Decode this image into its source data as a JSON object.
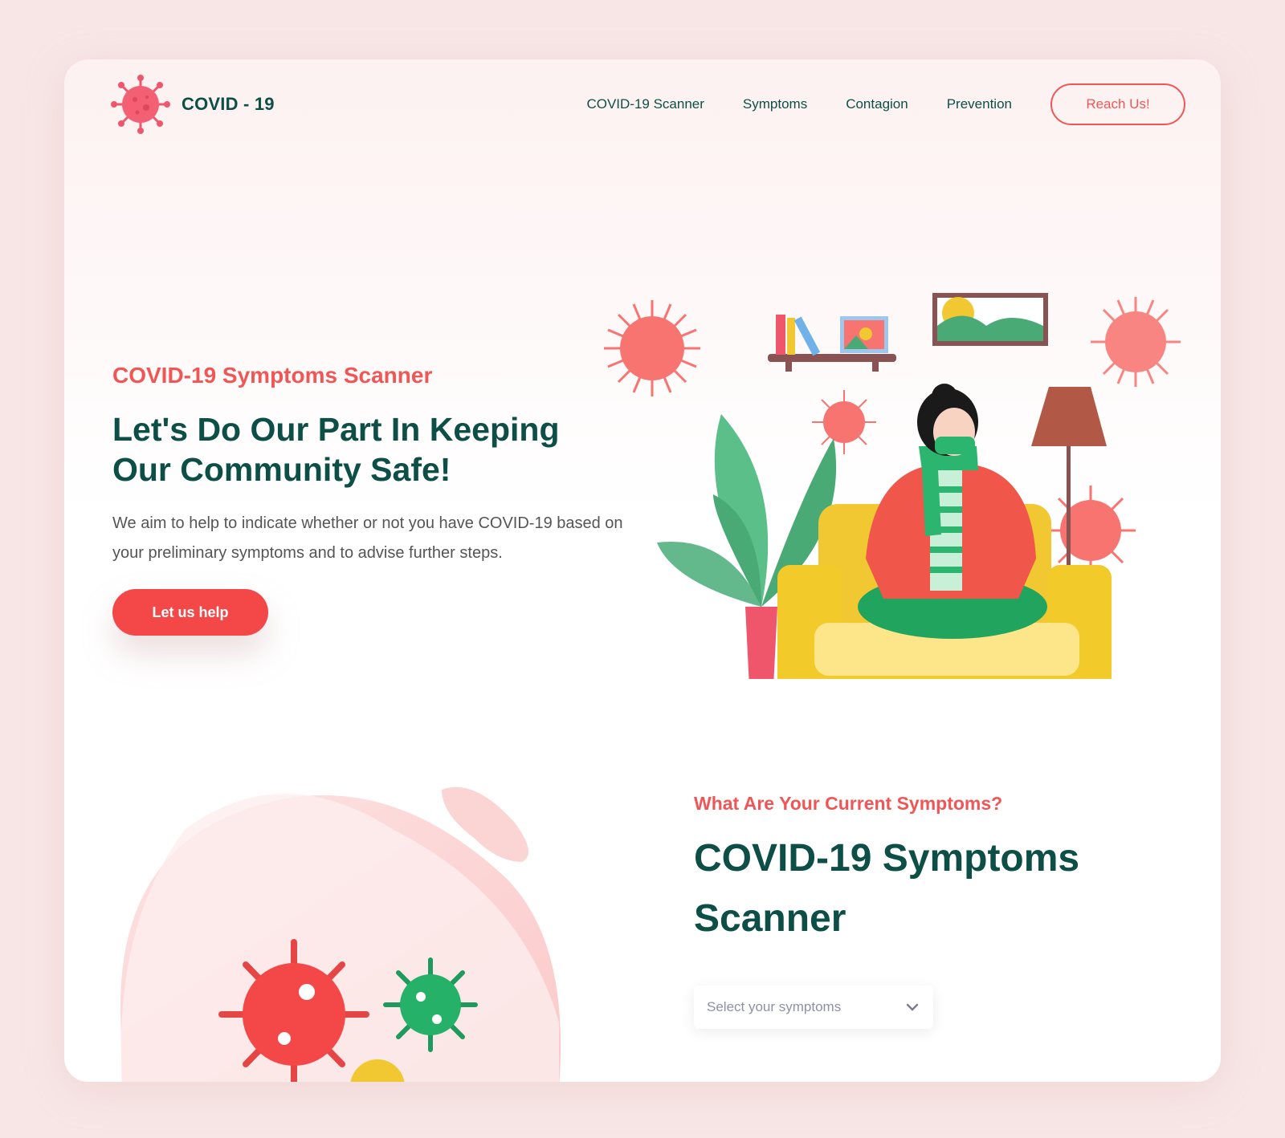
{
  "brand": {
    "name": "COVID - 19",
    "accent": "#f15656",
    "dark": "#0d4f47"
  },
  "nav": {
    "items": [
      {
        "label": "COVID-19 Scanner"
      },
      {
        "label": "Symptoms"
      },
      {
        "label": "Contagion"
      },
      {
        "label": "Prevention"
      }
    ],
    "cta_label": "Reach Us!"
  },
  "hero": {
    "kicker": "COVID-19 Symptoms Scanner",
    "title": "Let's Do Our Part In Keeping Our Community Safe!",
    "description": "We aim to help to indicate whether or not you have COVID-19 based on your preliminary symptoms and to advise further steps.",
    "button_label": "Let us help"
  },
  "scanner": {
    "kicker": "What Are Your Current Symptoms?",
    "title": "COVID-19 Symptoms Scanner",
    "select_placeholder": "Select your symptoms"
  }
}
